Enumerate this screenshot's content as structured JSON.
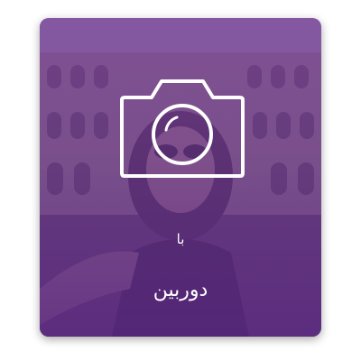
{
  "card": {
    "icon": "camera-icon",
    "line1": "با",
    "line2": "دوربین"
  },
  "colors": {
    "overlay": "#6a3590",
    "text": "#ffffff"
  }
}
